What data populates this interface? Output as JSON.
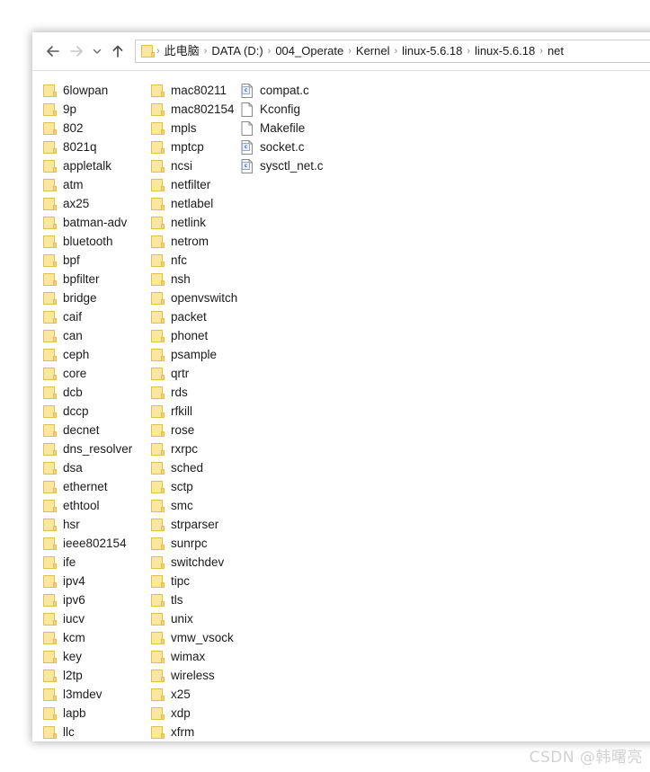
{
  "window": {
    "title": "net"
  },
  "toolbar": {
    "back_label": "Back",
    "forward_label": "Forward",
    "recent_label": "Recent locations",
    "up_label": "Up one level"
  },
  "address": {
    "folder_icon": "folder-icon",
    "separator": "›",
    "crumbs": [
      "此电脑",
      "DATA (D:)",
      "004_Operate",
      "Kernel",
      "linux-5.6.18",
      "linux-5.6.18",
      "net"
    ]
  },
  "file_list": {
    "columns": [
      {
        "name": "column-1",
        "items": [
          {
            "label": "6lowpan",
            "type": "folder"
          },
          {
            "label": "9p",
            "type": "folder"
          },
          {
            "label": "802",
            "type": "folder"
          },
          {
            "label": "8021q",
            "type": "folder"
          },
          {
            "label": "appletalk",
            "type": "folder"
          },
          {
            "label": "atm",
            "type": "folder"
          },
          {
            "label": "ax25",
            "type": "folder"
          },
          {
            "label": "batman-adv",
            "type": "folder"
          },
          {
            "label": "bluetooth",
            "type": "folder"
          },
          {
            "label": "bpf",
            "type": "folder"
          },
          {
            "label": "bpfilter",
            "type": "folder"
          },
          {
            "label": "bridge",
            "type": "folder"
          },
          {
            "label": "caif",
            "type": "folder"
          },
          {
            "label": "can",
            "type": "folder"
          },
          {
            "label": "ceph",
            "type": "folder"
          },
          {
            "label": "core",
            "type": "folder"
          },
          {
            "label": "dcb",
            "type": "folder"
          },
          {
            "label": "dccp",
            "type": "folder"
          },
          {
            "label": "decnet",
            "type": "folder"
          },
          {
            "label": "dns_resolver",
            "type": "folder"
          },
          {
            "label": "dsa",
            "type": "folder"
          },
          {
            "label": "ethernet",
            "type": "folder"
          },
          {
            "label": "ethtool",
            "type": "folder"
          },
          {
            "label": "hsr",
            "type": "folder"
          },
          {
            "label": "ieee802154",
            "type": "folder"
          },
          {
            "label": "ife",
            "type": "folder"
          },
          {
            "label": "ipv4",
            "type": "folder"
          },
          {
            "label": "ipv6",
            "type": "folder"
          },
          {
            "label": "iucv",
            "type": "folder"
          },
          {
            "label": "kcm",
            "type": "folder"
          },
          {
            "label": "key",
            "type": "folder"
          },
          {
            "label": "l2tp",
            "type": "folder"
          },
          {
            "label": "l3mdev",
            "type": "folder"
          },
          {
            "label": "lapb",
            "type": "folder"
          },
          {
            "label": "llc",
            "type": "folder"
          }
        ]
      },
      {
        "name": "column-2",
        "items": [
          {
            "label": "mac80211",
            "type": "folder"
          },
          {
            "label": "mac802154",
            "type": "folder"
          },
          {
            "label": "mpls",
            "type": "folder"
          },
          {
            "label": "mptcp",
            "type": "folder"
          },
          {
            "label": "ncsi",
            "type": "folder"
          },
          {
            "label": "netfilter",
            "type": "folder"
          },
          {
            "label": "netlabel",
            "type": "folder"
          },
          {
            "label": "netlink",
            "type": "folder"
          },
          {
            "label": "netrom",
            "type": "folder"
          },
          {
            "label": "nfc",
            "type": "folder"
          },
          {
            "label": "nsh",
            "type": "folder"
          },
          {
            "label": "openvswitch",
            "type": "folder"
          },
          {
            "label": "packet",
            "type": "folder"
          },
          {
            "label": "phonet",
            "type": "folder"
          },
          {
            "label": "psample",
            "type": "folder"
          },
          {
            "label": "qrtr",
            "type": "folder"
          },
          {
            "label": "rds",
            "type": "folder"
          },
          {
            "label": "rfkill",
            "type": "folder"
          },
          {
            "label": "rose",
            "type": "folder"
          },
          {
            "label": "rxrpc",
            "type": "folder"
          },
          {
            "label": "sched",
            "type": "folder"
          },
          {
            "label": "sctp",
            "type": "folder"
          },
          {
            "label": "smc",
            "type": "folder"
          },
          {
            "label": "strparser",
            "type": "folder"
          },
          {
            "label": "sunrpc",
            "type": "folder"
          },
          {
            "label": "switchdev",
            "type": "folder"
          },
          {
            "label": "tipc",
            "type": "folder"
          },
          {
            "label": "tls",
            "type": "folder"
          },
          {
            "label": "unix",
            "type": "folder"
          },
          {
            "label": "vmw_vsock",
            "type": "folder"
          },
          {
            "label": "wimax",
            "type": "folder"
          },
          {
            "label": "wireless",
            "type": "folder"
          },
          {
            "label": "x25",
            "type": "folder"
          },
          {
            "label": "xdp",
            "type": "folder"
          },
          {
            "label": "xfrm",
            "type": "folder"
          }
        ]
      },
      {
        "name": "column-3",
        "items": [
          {
            "label": "compat.c",
            "type": "cfile"
          },
          {
            "label": "Kconfig",
            "type": "file"
          },
          {
            "label": "Makefile",
            "type": "file"
          },
          {
            "label": "socket.c",
            "type": "cfile"
          },
          {
            "label": "sysctl_net.c",
            "type": "cfile"
          }
        ]
      }
    ]
  },
  "icons": {
    "c_badge_text": "c"
  },
  "watermark": {
    "text": "CSDN @韩曙亮"
  },
  "colors": {
    "folder_fill": "#FCE79E",
    "folder_border": "#E3BF52",
    "text": "#1B1B1B",
    "watermark": "#D2D2D2"
  }
}
